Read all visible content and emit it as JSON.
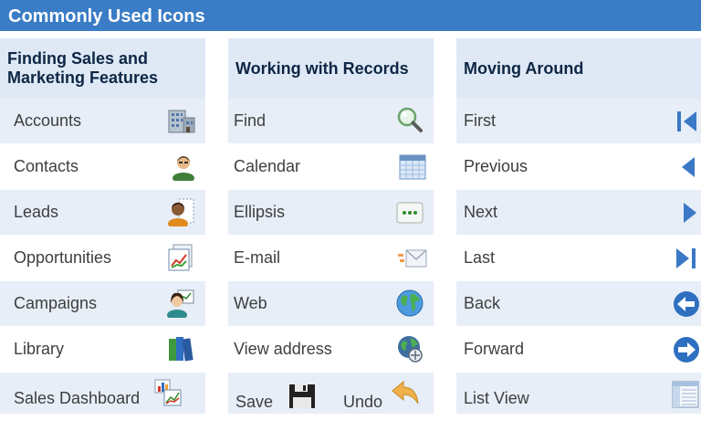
{
  "title": "Commonly Used Icons",
  "columns": [
    {
      "header": "Finding Sales and Marketing Features"
    },
    {
      "header": "Working with Records"
    },
    {
      "header": "Moving Around"
    }
  ],
  "rows": [
    {
      "c1": {
        "label": "Accounts",
        "icon": "accounts-building-icon"
      },
      "c2": {
        "label": "Find",
        "icon": "magnifier-icon"
      },
      "c3": {
        "label": "First",
        "icon": "first-record-icon"
      }
    },
    {
      "c1": {
        "label": "Contacts",
        "icon": "contact-person-icon"
      },
      "c2": {
        "label": "Calendar",
        "icon": "calendar-icon"
      },
      "c3": {
        "label": "Previous",
        "icon": "previous-arrow-icon"
      }
    },
    {
      "c1": {
        "label": "Leads",
        "icon": "lead-person-icon"
      },
      "c2": {
        "label": "Ellipsis",
        "icon": "ellipsis-icon"
      },
      "c3": {
        "label": "Next",
        "icon": "next-arrow-icon"
      }
    },
    {
      "c1": {
        "label": "Opportunities",
        "icon": "opportunity-chart-icon"
      },
      "c2": {
        "label": "E-mail",
        "icon": "envelope-icon"
      },
      "c3": {
        "label": "Last",
        "icon": "last-record-icon"
      }
    },
    {
      "c1": {
        "label": "Campaigns",
        "icon": "campaign-person-icon"
      },
      "c2": {
        "label": "Web",
        "icon": "globe-icon"
      },
      "c3": {
        "label": "Back",
        "icon": "back-circle-arrow-icon"
      }
    },
    {
      "c1": {
        "label": "Library",
        "icon": "books-icon"
      },
      "c2": {
        "label": "View address",
        "icon": "globe-map-icon"
      },
      "c3": {
        "label": "Forward",
        "icon": "forward-circle-arrow-icon"
      }
    },
    {
      "c1": {
        "label": "Sales Dashboard",
        "icon": "dashboard-chart-icon"
      },
      "c2": {
        "label": "Save",
        "icon": "floppy-disk-icon",
        "label2": "Undo",
        "icon2": "undo-arrow-icon"
      },
      "c3": {
        "label": "List View",
        "icon": "list-view-icon"
      }
    }
  ]
}
